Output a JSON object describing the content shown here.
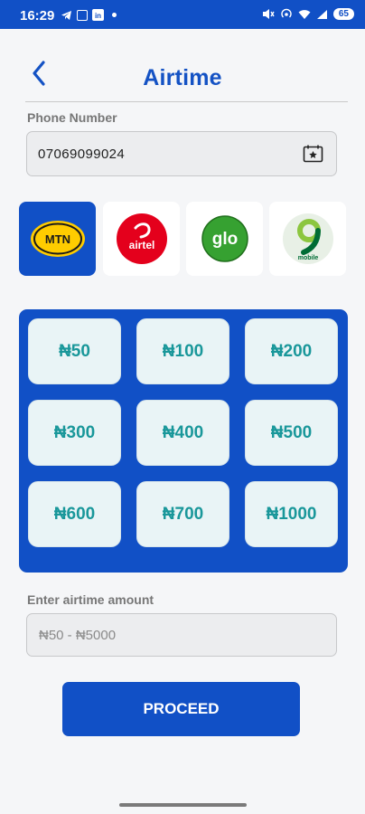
{
  "status_bar": {
    "time": "16:29",
    "battery": "65",
    "left_icons": [
      "telegram-icon",
      "screen-record-icon",
      "linkedin-icon",
      "notification-dot-icon"
    ],
    "right_icons": [
      "mute-icon",
      "hotspot-icon",
      "wifi-icon",
      "signal-icon",
      "battery-icon"
    ]
  },
  "header": {
    "title": "Airtime",
    "back_icon": "chevron-left-icon"
  },
  "phone": {
    "label": "Phone Number",
    "value": "07069099024",
    "contact_icon": "contact-book-icon"
  },
  "networks": [
    {
      "name": "MTN",
      "logo_text": "MTN",
      "selected": true,
      "color": "#ffcc00"
    },
    {
      "name": "airtel",
      "logo_text": "airtel",
      "selected": false,
      "color": "#e4001c"
    },
    {
      "name": "glo",
      "logo_text": "glo",
      "selected": false,
      "color": "#36a131"
    },
    {
      "name": "9mobile",
      "logo_text": "mobile",
      "selected": false,
      "color": "#006c35"
    }
  ],
  "amounts": [
    "₦50",
    "₦100",
    "₦200",
    "₦300",
    "₦400",
    "₦500",
    "₦600",
    "₦700",
    "₦1000"
  ],
  "amount_field": {
    "label": "Enter airtime amount",
    "placeholder": "₦50 - ₦5000",
    "value": ""
  },
  "proceed_label": "PROCEED",
  "colors": {
    "primary": "#1150c6",
    "amount_text": "#19979a",
    "amount_bg": "#e9f4f6"
  }
}
